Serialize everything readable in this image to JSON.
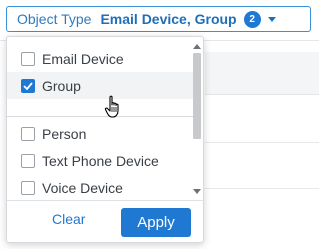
{
  "filter": {
    "label": "Object Type",
    "value": "Email Device, Group",
    "count": "2"
  },
  "dropdown": {
    "options_top": [
      {
        "label": "Email Device",
        "checked": false
      },
      {
        "label": "Group",
        "checked": true,
        "hovered": true
      }
    ],
    "options_bottom": [
      {
        "label": "Person",
        "checked": false
      },
      {
        "label": "Text Phone Device",
        "checked": false
      },
      {
        "label": "Voice Device",
        "checked": false
      }
    ],
    "clear_label": "Clear",
    "apply_label": "Apply"
  },
  "colors": {
    "accent": "#1f78d1",
    "chip_border": "#3b8ed8",
    "text": "#3a3f45"
  },
  "icons": [
    "chevron-down-icon",
    "checkmark-icon",
    "hand-pointer-cursor-icon"
  ]
}
